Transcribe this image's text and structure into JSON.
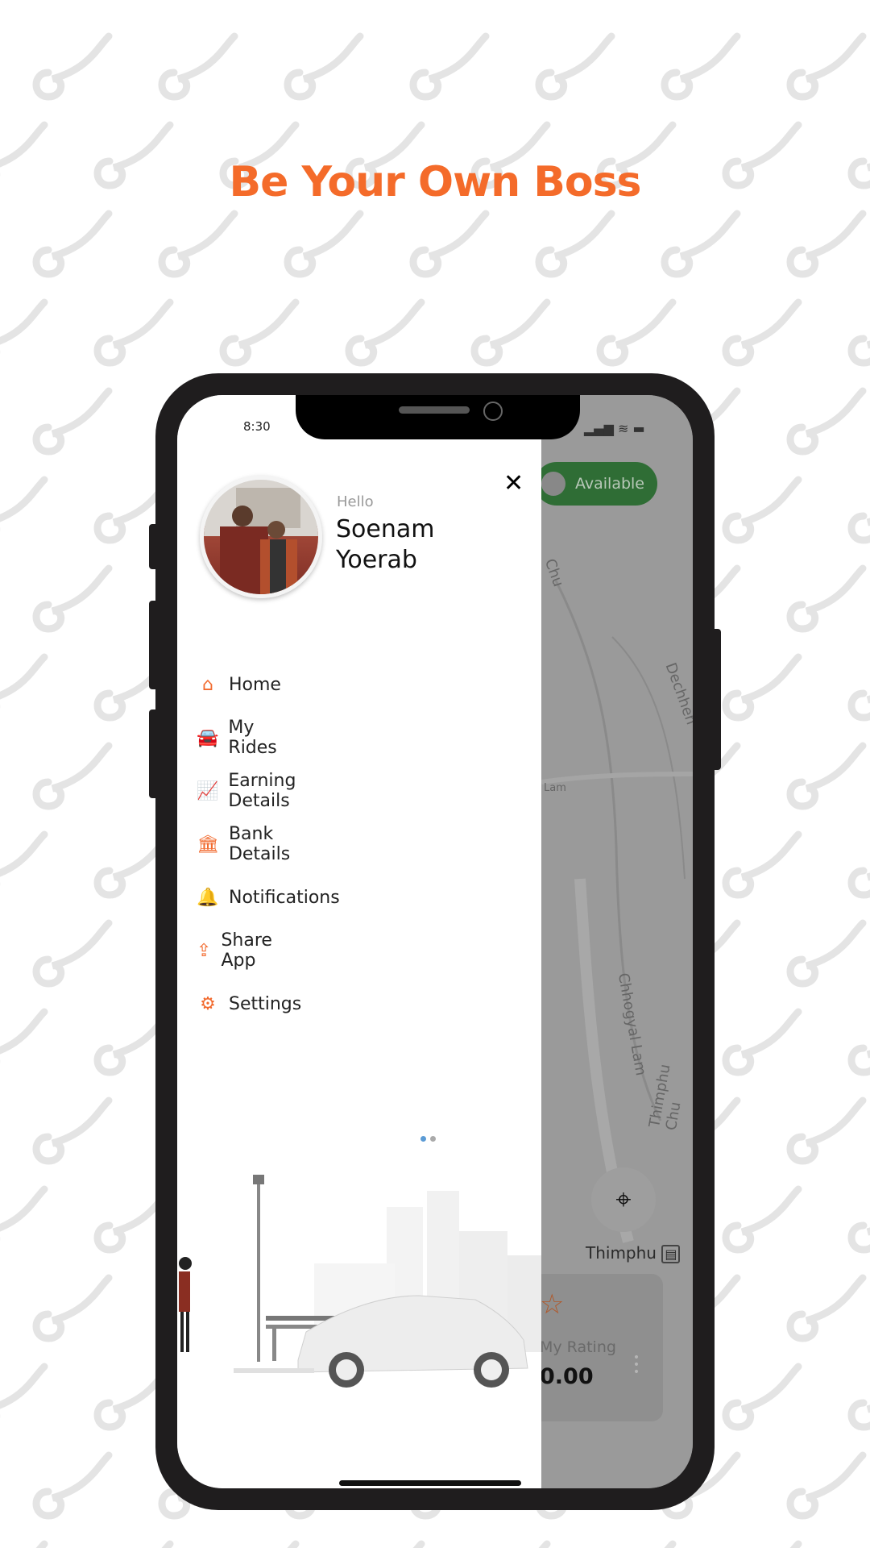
{
  "headline": "Be Your Own Boss",
  "colors": {
    "accent": "#f46b2a",
    "available": "#2f6d35"
  },
  "status_bar": {
    "time": "8:30",
    "icons": [
      "signal-icon",
      "wifi-icon",
      "battery-icon"
    ]
  },
  "drawer": {
    "greeting": "Hello",
    "first_name": "Soenam",
    "last_name": "Yoerab",
    "close_icon": "close-icon",
    "items": [
      {
        "label": "Home",
        "icon": "home-icon",
        "glyph": "⌂"
      },
      {
        "label": "My Rides",
        "icon": "car-icon",
        "glyph": "🚘"
      },
      {
        "label": "Earning Details",
        "icon": "chart-icon",
        "glyph": "📈"
      },
      {
        "label": "Bank Details",
        "icon": "bank-icon",
        "glyph": "🏛"
      },
      {
        "label": "Notifications",
        "icon": "bell-icon",
        "glyph": "🔔"
      },
      {
        "label": "Share App",
        "icon": "share-icon",
        "glyph": "⇪"
      },
      {
        "label": "Settings",
        "icon": "gear-icon",
        "glyph": "⚙"
      }
    ],
    "pager": {
      "pages": 2,
      "active": 1
    }
  },
  "map": {
    "availability_label": "Available",
    "roads": [
      "Dechhen",
      "Chhogyal Lam",
      "Thimphu Chu",
      "Lam",
      "Chu"
    ],
    "city": "Thimphu",
    "rating_label": "My Rating",
    "rating_value": "0.00"
  }
}
